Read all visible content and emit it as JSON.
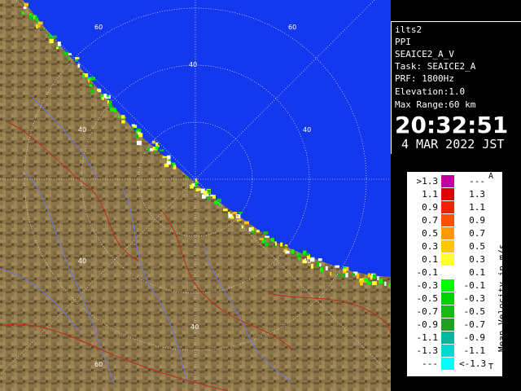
{
  "radar": {
    "site": "ilts2",
    "product": "PPI",
    "scan": "SEAICE2_A_V",
    "task_line": "Task: SEAICE2_A",
    "prf_line": "PRF: 1800Hz",
    "elevation_line": "Elevation:1.0",
    "range_line": "Max Range:60 km",
    "time": "20:32:51",
    "date": "4 MAR 2022 JST"
  },
  "range_labels": [
    "60",
    "40",
    "60",
    "40",
    "40",
    "40",
    "40",
    "40",
    "60"
  ],
  "colors": {
    "sea": "#1438ee",
    "land": "#8b7448",
    "panel_bg": "#000000"
  },
  "legend": {
    "caption": "Mean Velocity in m/s",
    "marker_top": "A",
    "marker_bottom": "T",
    "rows": [
      {
        "lo": ">1.3",
        "hi": "---",
        "color": "#c000a0"
      },
      {
        "lo": "1.1",
        "hi": "1.3",
        "color": "#e00000"
      },
      {
        "lo": "0.9",
        "hi": "1.1",
        "color": "#f42000"
      },
      {
        "lo": "0.7",
        "hi": "0.9",
        "color": "#ff5000"
      },
      {
        "lo": "0.5",
        "hi": "0.7",
        "color": "#ff9a00"
      },
      {
        "lo": "0.3",
        "hi": "0.5",
        "color": "#ffc800"
      },
      {
        "lo": "0.1",
        "hi": "0.3",
        "color": "#ffff30"
      },
      {
        "lo": "-0.1",
        "hi": "0.1",
        "color": "#ffffff"
      },
      {
        "lo": "-0.3",
        "hi": "-0.1",
        "color": "#00ff00"
      },
      {
        "lo": "-0.5",
        "hi": "-0.3",
        "color": "#00d000"
      },
      {
        "lo": "-0.7",
        "hi": "-0.5",
        "color": "#18b818"
      },
      {
        "lo": "-0.9",
        "hi": "-0.7",
        "color": "#20a020"
      },
      {
        "lo": "-1.1",
        "hi": "-0.9",
        "color": "#00b8a0"
      },
      {
        "lo": "-1.3",
        "hi": "-1.1",
        "color": "#00d8d0"
      },
      {
        "lo": "---",
        "hi": "<-1.3",
        "color": "#00ffff"
      }
    ]
  }
}
